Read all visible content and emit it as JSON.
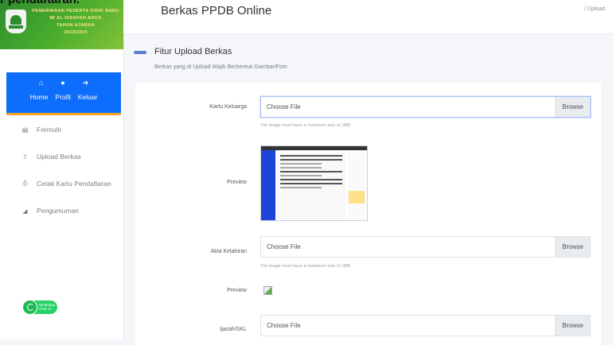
{
  "page": {
    "overflow_title": "r pendaftaran."
  },
  "brand": {
    "lines": [
      "PENERIMAAN PESERTA DIDIK BARU",
      "MI AL-HIDAYAH ARCO",
      "TAHUN AJARAN",
      "2023/2024"
    ]
  },
  "usercard": {
    "home_label": "Home",
    "profile_label": "Profil",
    "logout_label": "Keluar"
  },
  "sidebar": {
    "items": [
      {
        "label": "Formulir",
        "icon": "form-icon"
      },
      {
        "label": "Upload Berkas",
        "icon": "upload-icon"
      },
      {
        "label": "Cetak Kartu Pendaftaran",
        "icon": "print-icon"
      },
      {
        "label": "Pengumuman",
        "icon": "megaphone-icon"
      }
    ]
  },
  "whatsapp": {
    "line1": "Whatsapp",
    "line2": "Chat us"
  },
  "header": {
    "title": "Berkas PPDB Online",
    "breadcrumb": "/ Upload"
  },
  "section": {
    "title": "Fitur Upload Berkas",
    "subtitle": "Berkas yang di Upload Wajib Berbentuk Gambar/Foto"
  },
  "form": {
    "kk": {
      "label": "Kartu Keluarga",
      "placeholder": "Choose File",
      "browse": "Browse",
      "help": "The image must have a maximum size of 1MB"
    },
    "preview1_label": "Preview",
    "akta": {
      "label": "Akta Kelahiran",
      "placeholder": "Choose File",
      "browse": "Browse",
      "help": "The image must have a maximum size of 1MB"
    },
    "preview2_label": "Preview",
    "ijazah": {
      "label": "Ijazah/SKL",
      "placeholder": "Choose File",
      "browse": "Browse"
    }
  },
  "colors": {
    "accent": "#0d6efd",
    "brand_green": "#4caf2c",
    "usercard_border": "#f5a623"
  }
}
